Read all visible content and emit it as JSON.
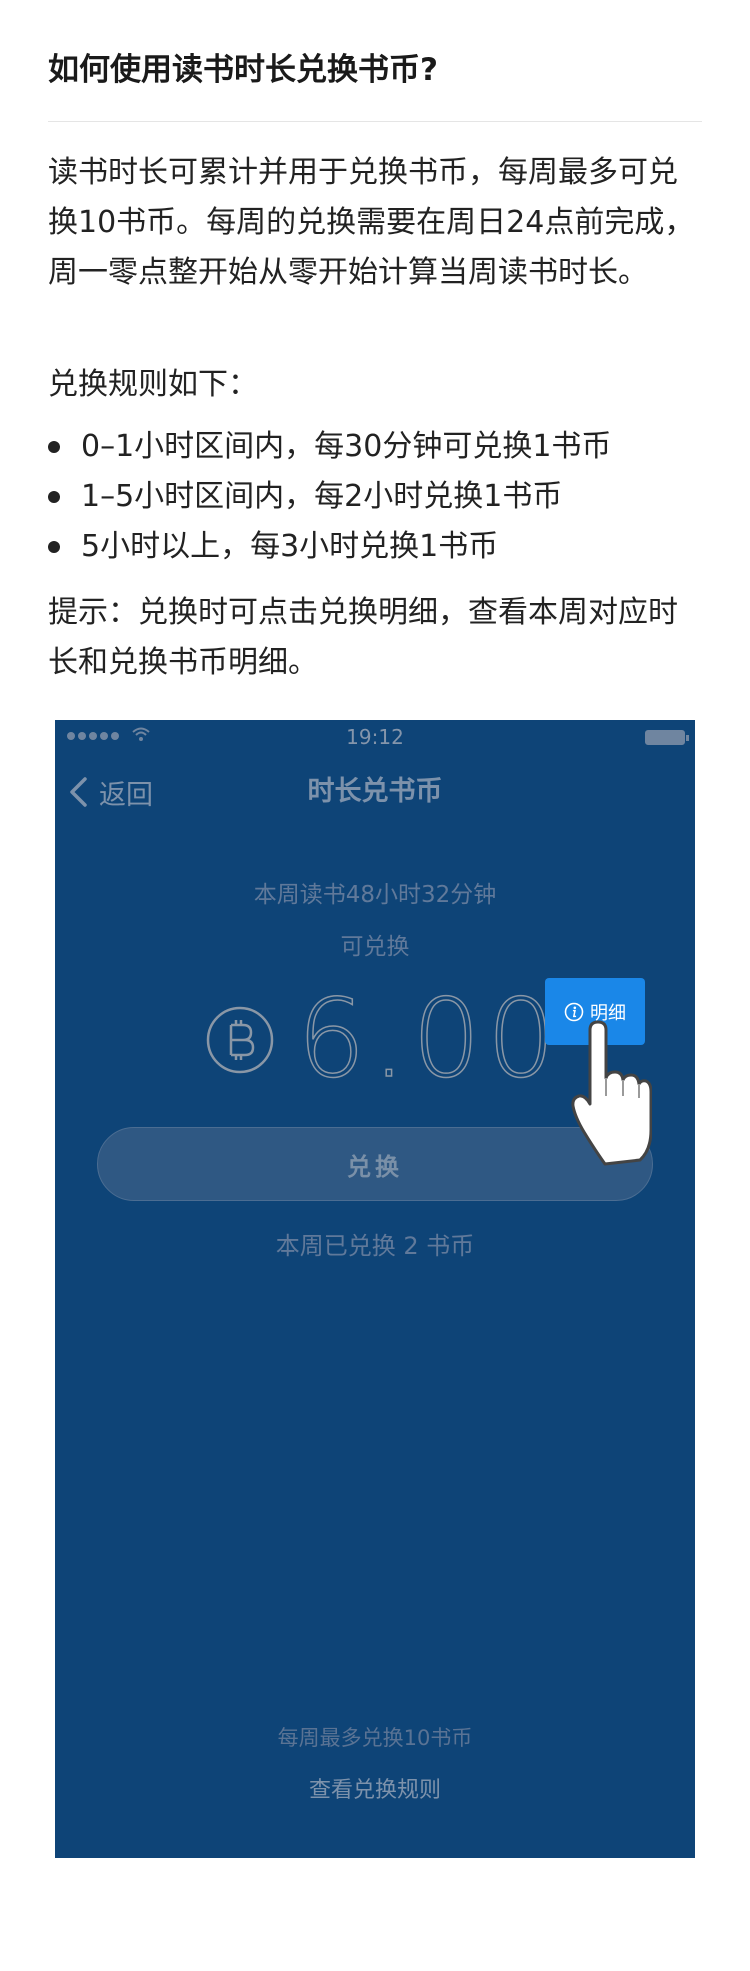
{
  "article": {
    "title": "如何使用读书时长兑换书币?",
    "intro": "读书时长可累计并用于兑换书币，每周最多可兑换10书币。每周的兑换需要在周日24点前完成，周一零点整开始从零开始计算当周读书时长。",
    "rules_intro": "兑换规则如下：",
    "rules": [
      "0–1小时区间内，每30分钟可兑换1书币",
      "1–5小时区间内，每2小时兑换1书币",
      "5小时以上，每3小时兑换1书币"
    ],
    "tip": "提示：兑换时可点击兑换明细，查看本周对应时长和兑换书币明细。"
  },
  "phone": {
    "status_time": "19:12",
    "back_label": "返回",
    "nav_title": "时长兑书币",
    "week_reading": "本周读书48小时32分钟",
    "can_exchange": "可兑换",
    "amount": "6.00",
    "detail_label": "明细",
    "exchange_label": "兑换",
    "exchanged_info": "本周已兑换 2 书币",
    "weekly_max": "每周最多兑换10书币",
    "view_rules": "查看兑换规则"
  },
  "colors": {
    "phone_background": "#0e4477",
    "detail_button": "#1a87e8"
  }
}
